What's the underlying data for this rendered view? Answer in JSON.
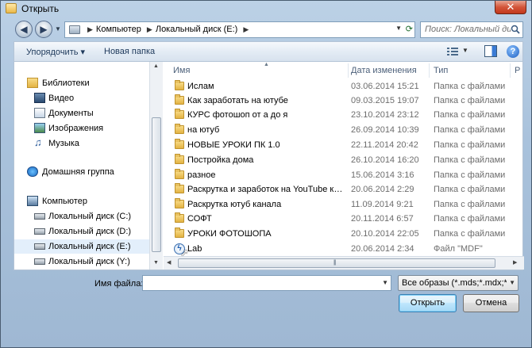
{
  "window": {
    "title": "Открыть",
    "close_glyph": "✕"
  },
  "nav": {
    "back_glyph": "◀",
    "forward_glyph": "▶",
    "breadcrumbs": [
      "Компьютер",
      "Локальный диск (E:)"
    ],
    "search_placeholder": "Поиск: Локальный дис..."
  },
  "toolbar": {
    "organize_label": "Упорядочить ▾",
    "new_folder_label": "Новая папка",
    "help_glyph": "?"
  },
  "sidebar": {
    "items": [
      {
        "label": "Библиотеки",
        "icon": "libraries-icon"
      },
      {
        "label": "Видео",
        "icon": "video-icon"
      },
      {
        "label": "Документы",
        "icon": "documents-icon"
      },
      {
        "label": "Изображения",
        "icon": "pictures-icon"
      },
      {
        "label": "Музыка",
        "icon": "music-icon"
      },
      {
        "label": "Домашняя группа",
        "icon": "homegroup-icon"
      },
      {
        "label": "Компьютер",
        "icon": "computer-icon"
      },
      {
        "label": "Локальный диск (C:)",
        "icon": "drive-icon"
      },
      {
        "label": "Локальный диск (D:)",
        "icon": "drive-icon"
      },
      {
        "label": "Локальный диск (E:)",
        "icon": "drive-icon",
        "selected": true
      },
      {
        "label": "Локальный диск (Y:)",
        "icon": "drive-icon"
      }
    ]
  },
  "columns": {
    "name": "Имя",
    "date": "Дата изменения",
    "type": "Тип",
    "extra": "Р"
  },
  "files": [
    {
      "name": "Ислам",
      "date": "03.06.2014 15:21",
      "type": "Папка с файлами",
      "kind": "folder"
    },
    {
      "name": "Как заработать на ютубе",
      "date": "09.03.2015 19:07",
      "type": "Папка с файлами",
      "kind": "folder"
    },
    {
      "name": "КУРС фотошоп от а до я",
      "date": "23.10.2014 23:12",
      "type": "Папка с файлами",
      "kind": "folder"
    },
    {
      "name": "на ютуб",
      "date": "26.09.2014 10:39",
      "type": "Папка с файлами",
      "kind": "folder"
    },
    {
      "name": "НОВЫЕ УРОКИ ПК 1.0",
      "date": "22.11.2014 20:42",
      "type": "Папка с файлами",
      "kind": "folder"
    },
    {
      "name": "Постройка дома",
      "date": "26.10.2014 16:20",
      "type": "Папка с файлами",
      "kind": "folder"
    },
    {
      "name": "разное",
      "date": "15.06.2014 3:16",
      "type": "Папка с файлами",
      "kind": "folder"
    },
    {
      "name": "Раскрутка и заработок на YouTube кан...",
      "date": "20.06.2014 2:29",
      "type": "Папка с файлами",
      "kind": "folder"
    },
    {
      "name": "Раскрутка ютуб канала",
      "date": "11.09.2014 9:21",
      "type": "Папка с файлами",
      "kind": "folder"
    },
    {
      "name": "СОФТ",
      "date": "20.11.2014 6:57",
      "type": "Папка с файлами",
      "kind": "folder"
    },
    {
      "name": "УРОКИ ФОТОШОПА",
      "date": "20.10.2014 22:05",
      "type": "Папка с файлами",
      "kind": "folder"
    },
    {
      "name": "Lab",
      "date": "20.06.2014 2:34",
      "type": "Файл \"MDF\"",
      "kind": "daemon"
    }
  ],
  "bottom": {
    "filename_label": "Имя файла:",
    "filename_value": "",
    "filter_value": "Все образы (*.mds;*.mdx;*.b",
    "open_label": "Открыть",
    "cancel_label": "Отмена"
  }
}
